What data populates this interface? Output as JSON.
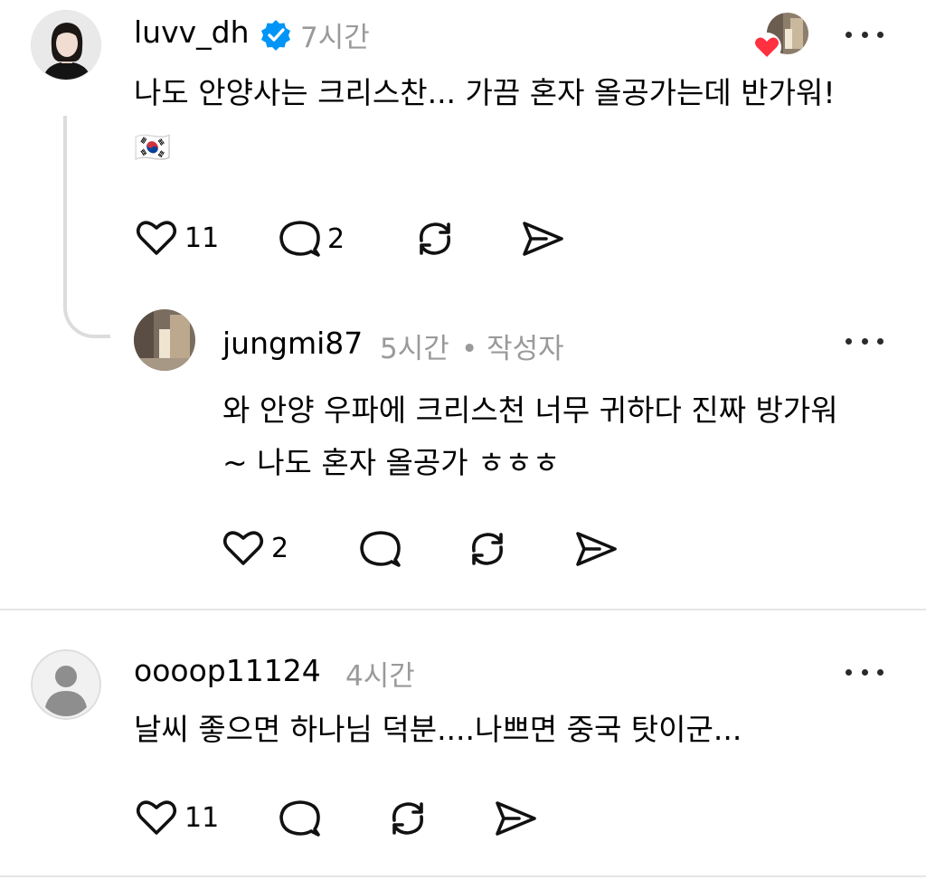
{
  "comments": [
    {
      "username": "luvv_dh",
      "time": "7시간",
      "text_line1": "나도 안양사는 크리스찬... 가끔 혼자 올공가는데 반가워!",
      "flag_emoji": "🇰🇷",
      "likes": "11",
      "replies": "2",
      "verified": true
    },
    {
      "username": "jungmi87",
      "time": "5시간",
      "author_tag": "• 작성자",
      "text_line1": "와 안양 우파에 크리스천 너무 귀하다 진짜 방가워",
      "text_line2": "~ 나도 혼자 올공가 ㅎㅎㅎ",
      "likes": "2"
    },
    {
      "username": "oooop11124",
      "time": "4시간",
      "text_line1": "날씨 좋으면 하나님 덕분....나쁘면 중국 탓이군...",
      "likes": "11"
    }
  ],
  "icons": {
    "verified": "verified-badge-icon",
    "like": "heart-icon",
    "reply": "speech-bubble-icon",
    "repost": "repost-icon",
    "share": "send-icon",
    "more": "more-dots-icon"
  },
  "colors": {
    "verified_blue": "#0095f6",
    "heart_red": "#ff3040",
    "meta_gray": "#9a9a9a",
    "divider": "#e6e6e6"
  }
}
